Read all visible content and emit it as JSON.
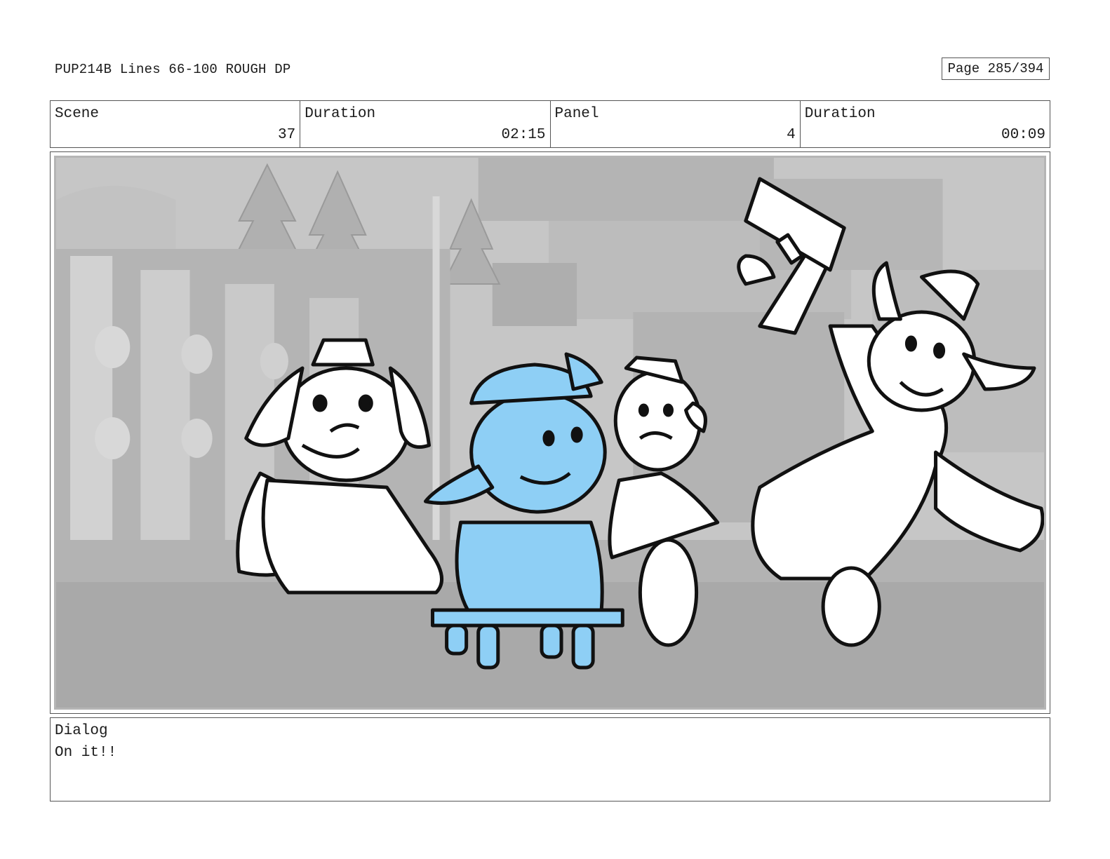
{
  "header": {
    "doc_title": "PUP214B Lines 66-100 ROUGH DP",
    "page_label": "Page 285/394"
  },
  "info": {
    "scene_label": "Scene",
    "scene_value": "37",
    "scene_duration_label": "Duration",
    "scene_duration_value": "02:15",
    "panel_label": "Panel",
    "panel_value": "4",
    "panel_duration_label": "Duration",
    "panel_duration_value": "00:09"
  },
  "dialog": {
    "label": "Dialog",
    "text": "On it!!"
  },
  "colors": {
    "highlight_character": "#8ecff5",
    "background_gray": "#c8c8c8"
  }
}
